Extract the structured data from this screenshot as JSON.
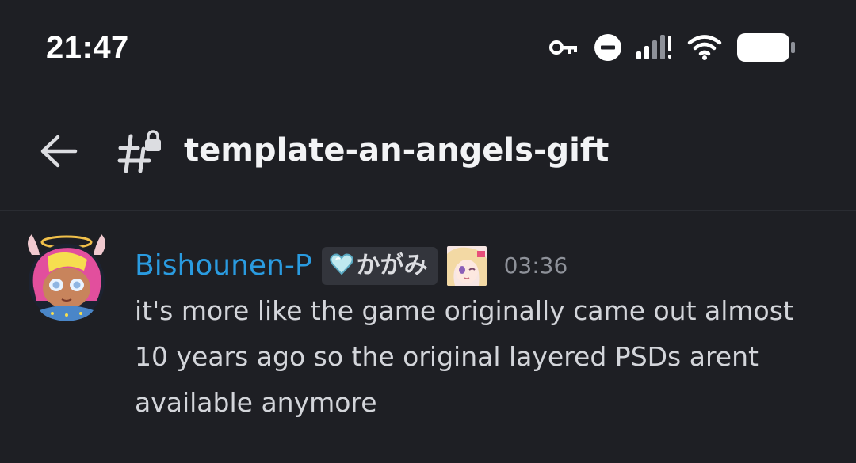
{
  "status_bar": {
    "time": "21:47",
    "icons": [
      "vpn-key-icon",
      "do-not-disturb-icon",
      "signal-icon",
      "wifi-icon",
      "battery-icon"
    ]
  },
  "header": {
    "back_icon": "arrow-left-icon",
    "channel_icon": "locked-text-channel-icon",
    "channel_name": "template-an-angels-gift"
  },
  "message": {
    "author": "Bishounen-P",
    "author_color": "#2a9be0",
    "tag": {
      "icon": "heart-icon",
      "text": "かがみ"
    },
    "role_icon": "anime-character-icon",
    "timestamp": "03:36",
    "lines": [
      "it's more like the game originally came out almost",
      "10 years ago so the original layered PSDs arent",
      "available anymore"
    ]
  },
  "colors": {
    "background": "#1e1f24",
    "text": "#d3d5da",
    "muted": "#8e9199"
  }
}
